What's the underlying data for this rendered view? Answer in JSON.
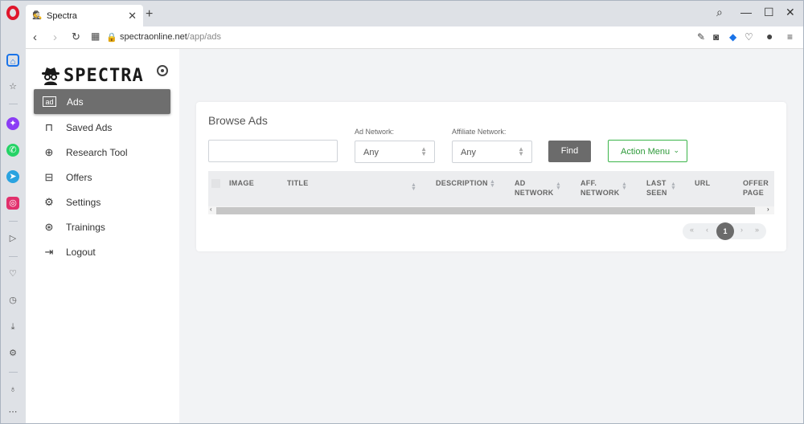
{
  "browser": {
    "tab_title": "Spectra",
    "url_domain": "spectraonline.net",
    "url_path": "/app/ads"
  },
  "app": {
    "brand": "SPECTRA",
    "sidebar": {
      "items": [
        {
          "label": "Ads",
          "icon": "ad-icon",
          "active": true
        },
        {
          "label": "Saved Ads",
          "icon": "bookmark-icon"
        },
        {
          "label": "Research Tool",
          "icon": "globe-icon"
        },
        {
          "label": "Offers",
          "icon": "archive-icon"
        },
        {
          "label": "Settings",
          "icon": "gear-icon"
        },
        {
          "label": "Trainings",
          "icon": "lifebuoy-icon"
        },
        {
          "label": "Logout",
          "icon": "logout-icon"
        }
      ]
    }
  },
  "browse": {
    "title": "Browse Ads",
    "search_value": "",
    "ad_network_label": "Ad Network:",
    "ad_network_value": "Any",
    "affiliate_network_label": "Affiliate Network:",
    "affiliate_network_value": "Any",
    "find_label": "Find",
    "action_menu_label": "Action Menu",
    "columns": {
      "image": "IMAGE",
      "title": "TITLE",
      "description": "DESCRIPTION",
      "ad_network_1": "AD",
      "ad_network_2": "NETWORK",
      "aff_network_1": "AFF.",
      "aff_network_2": "NETWORK",
      "last_seen_1": "LAST",
      "last_seen_2": "SEEN",
      "url": "URL",
      "offer_page_1": "OFFER",
      "offer_page_2": "PAGE"
    },
    "current_page": "1"
  },
  "colors": {
    "active_item": "#6e6e6e",
    "find_button": "#6b6b6b",
    "action_menu_border": "#3bb54a",
    "opera_red": "#e0162b"
  }
}
